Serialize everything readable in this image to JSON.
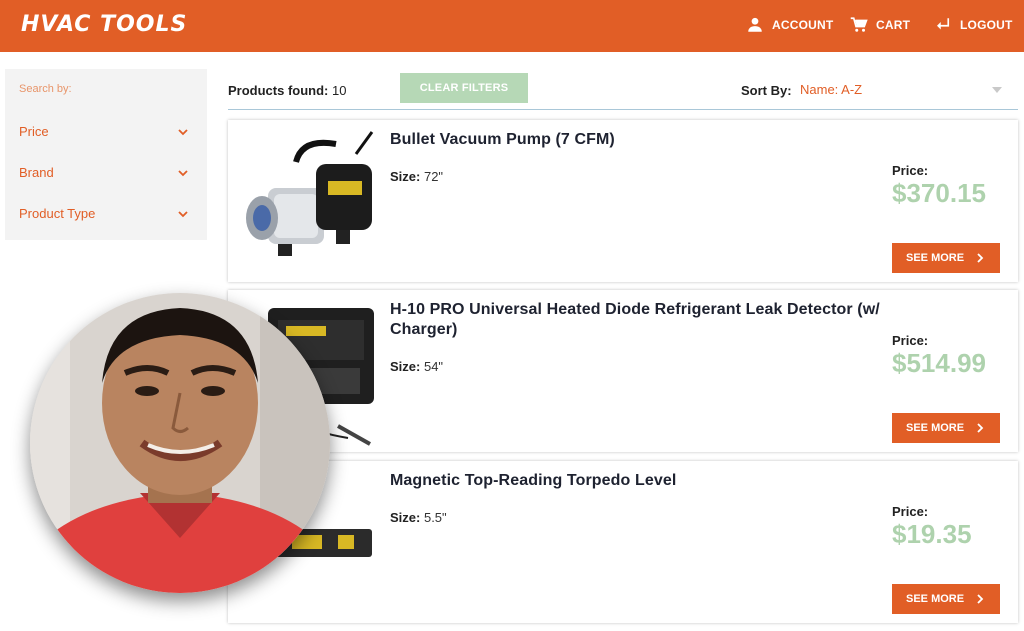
{
  "header": {
    "logo": "HVAC TOOLS",
    "nav": [
      {
        "label": "ACCOUNT",
        "icon": "person-icon"
      },
      {
        "label": "CART",
        "icon": "cart-icon"
      },
      {
        "label": "LOGOUT",
        "icon": "logout-icon"
      }
    ]
  },
  "sidebar": {
    "heading": "Search by:",
    "filters": [
      {
        "label": "Price"
      },
      {
        "label": "Brand"
      },
      {
        "label": "Product Type"
      }
    ]
  },
  "toolbar": {
    "products_found_label": "Products found:",
    "products_found_count": "10",
    "clear_filters": "CLEAR FILTERS",
    "sort_label": "Sort By:",
    "sort_value": "Name: A-Z"
  },
  "products": [
    {
      "title": "Bullet Vacuum Pump (7 CFM)",
      "size_label": "Size:",
      "size": "72\"",
      "price_label": "Price:",
      "price": "$370.15",
      "button": "SEE MORE"
    },
    {
      "title": "H-10 PRO Universal Heated Diode Refrigerant Leak Detector (w/ Charger)",
      "size_label": "Size:",
      "size": "54\"",
      "price_label": "Price:",
      "price": "$514.99",
      "button": "SEE MORE"
    },
    {
      "title": "Magnetic Top-Reading Torpedo Level",
      "size_label": "Size:",
      "size": "5.5\"",
      "price_label": "Price:",
      "price": "$19.35",
      "button": "SEE MORE"
    }
  ],
  "colors": {
    "brand": "#e15e26",
    "price_green": "#aed2ad",
    "clear_button": "#b6d8b6"
  }
}
